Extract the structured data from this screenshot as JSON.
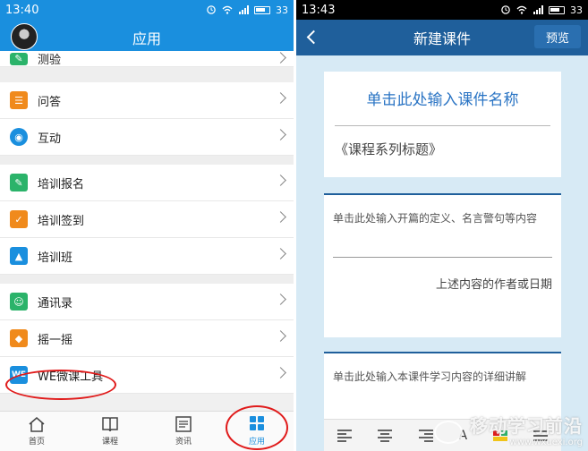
{
  "left": {
    "status": {
      "time": "13:40",
      "battery": "33"
    },
    "header": {
      "title": "应用"
    },
    "items": [
      {
        "label": "测验",
        "icon": "quiz-icon",
        "color": "#2bb36a"
      },
      {
        "label": "问答",
        "icon": "qa-icon",
        "color": "#f08a1c"
      },
      {
        "label": "互动",
        "icon": "interact-icon",
        "color": "#1a8fde"
      },
      {
        "label": "培训报名",
        "icon": "signup-icon",
        "color": "#2bb36a"
      },
      {
        "label": "培训签到",
        "icon": "checkin-icon",
        "color": "#f08a1c"
      },
      {
        "label": "培训班",
        "icon": "class-icon",
        "color": "#1a8fde"
      },
      {
        "label": "通讯录",
        "icon": "contacts-icon",
        "color": "#2bb36a"
      },
      {
        "label": "摇一摇",
        "icon": "shake-icon",
        "color": "#f08a1c"
      },
      {
        "label": "WE微课工具",
        "icon": "we-icon",
        "color": "#1a8fde",
        "icon_text": "WE"
      }
    ],
    "tabs": [
      {
        "label": "首页",
        "icon": "home-icon"
      },
      {
        "label": "课程",
        "icon": "book-icon"
      },
      {
        "label": "资讯",
        "icon": "news-icon"
      },
      {
        "label": "应用",
        "icon": "apps-icon",
        "active": true
      }
    ]
  },
  "right": {
    "status": {
      "time": "13:43",
      "battery": "33"
    },
    "header": {
      "title": "新建课件",
      "preview": "预览"
    },
    "card1": {
      "name_placeholder": "单击此处输入课件名称",
      "series": "《课程系列标题》"
    },
    "card2": {
      "opening": "单击此处输入开篇的定义、名言警句等内容",
      "author": "上述内容的作者或日期"
    },
    "card3": {
      "detail": "单击此处输入本课件学习内容的详细讲解"
    },
    "toolbar": {
      "font_label": "A"
    },
    "watermark": {
      "title": "移动学习前沿",
      "url": "www.wxuexi.org"
    }
  },
  "colors": {
    "accent": "#1a8fde",
    "dark_header": "#1f5f9b",
    "highlight": "#e01b1b"
  }
}
